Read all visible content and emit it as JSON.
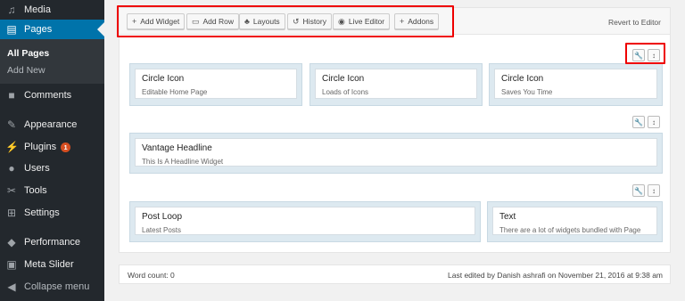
{
  "sidebar": {
    "media": "Media",
    "pages": "Pages",
    "all_pages": "All Pages",
    "add_new": "Add New",
    "comments": "Comments",
    "appearance": "Appearance",
    "plugins": "Plugins",
    "plugins_badge": "1",
    "users": "Users",
    "tools": "Tools",
    "settings": "Settings",
    "performance": "Performance",
    "meta_slider": "Meta Slider",
    "collapse": "Collapse menu"
  },
  "toolbar": {
    "add_widget": "Add Widget",
    "add_row": "Add Row",
    "layouts": "Layouts",
    "history": "History",
    "live_editor": "Live Editor",
    "addons": "Addons",
    "revert": "Revert to Editor"
  },
  "rows": {
    "r1": [
      {
        "title": "Circle Icon",
        "desc": "Editable Home Page"
      },
      {
        "title": "Circle Icon",
        "desc": "Loads of Icons"
      },
      {
        "title": "Circle Icon",
        "desc": "Saves You Time"
      }
    ],
    "r2": [
      {
        "title": "Vantage Headline",
        "desc": "This Is A Headline Widget"
      }
    ],
    "r3": [
      {
        "title": "Post Loop",
        "desc": "Latest Posts"
      },
      {
        "title": "Text",
        "desc": "There are a lot of widgets bundled with Page"
      }
    ]
  },
  "footer": {
    "word_count": "Word count: 0",
    "last_edited": "Last edited by Danish ashrafi on November 21, 2016 at 9:38 am"
  },
  "colors": {
    "sidebar_bg": "#23282d",
    "active_blue": "#0073aa",
    "highlight_red": "#e00000",
    "cell_bg": "#dde9f0"
  }
}
